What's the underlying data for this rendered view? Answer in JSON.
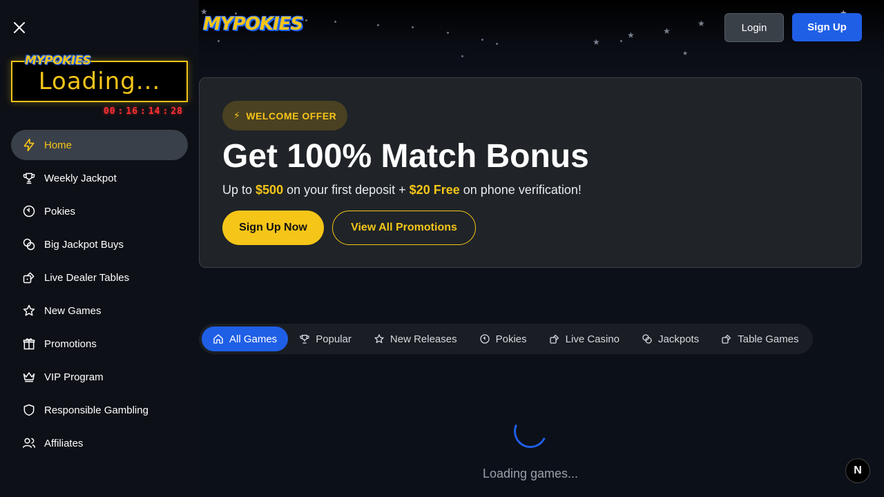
{
  "sidebar": {
    "jackpot": {
      "logo": "MYPOKIES",
      "display": "Loading...",
      "timer": [
        "00",
        "16",
        "14",
        "28"
      ]
    },
    "items": [
      {
        "label": "Home",
        "icon": "bolt-icon",
        "active": true
      },
      {
        "label": "Weekly Jackpot",
        "icon": "trophy-icon"
      },
      {
        "label": "Pokies",
        "icon": "clock-icon"
      },
      {
        "label": "Big Jackpot Buys",
        "icon": "coins-icon"
      },
      {
        "label": "Live Dealer Tables",
        "icon": "dice-icon"
      },
      {
        "label": "New Games",
        "icon": "star-icon"
      },
      {
        "label": "Promotions",
        "icon": "gift-icon"
      },
      {
        "label": "VIP Program",
        "icon": "crown-icon"
      },
      {
        "label": "Responsible Gambling",
        "icon": "shield-icon"
      },
      {
        "label": "Affiliates",
        "icon": "users-icon"
      }
    ]
  },
  "header": {
    "logo": "MYPOKIES",
    "login_label": "Login",
    "signup_label": "Sign Up"
  },
  "promo": {
    "badge": "WELCOME OFFER",
    "title": "Get 100% Match Bonus",
    "sub_prefix": "Up to ",
    "sub_amount1": "$500",
    "sub_mid": " on your first deposit + ",
    "sub_amount2": "$20 Free",
    "sub_suffix": " on phone verification!",
    "primary_label": "Sign Up Now",
    "secondary_label": "View All Promotions"
  },
  "tabs": [
    {
      "label": "All Games",
      "icon": "home-icon",
      "active": true
    },
    {
      "label": "Popular",
      "icon": "trophy-icon"
    },
    {
      "label": "New Releases",
      "icon": "star-icon"
    },
    {
      "label": "Pokies",
      "icon": "clock-icon"
    },
    {
      "label": "Live Casino",
      "icon": "dice-icon"
    },
    {
      "label": "Jackpots",
      "icon": "coins-icon"
    },
    {
      "label": "Table Games",
      "icon": "dice-icon"
    }
  ],
  "loading_text": "Loading games...",
  "next_badge": "N",
  "colors": {
    "accent": "#f5c518",
    "primary": "#1f5fe6",
    "timer": "#ff3030"
  }
}
